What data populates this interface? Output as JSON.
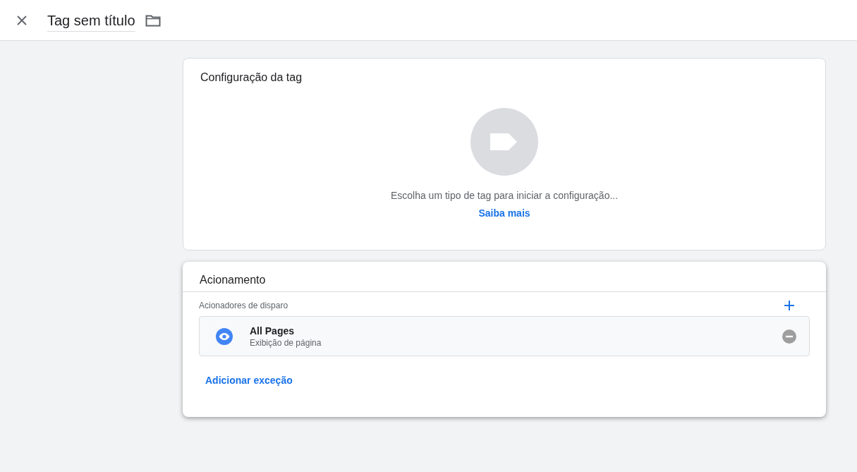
{
  "header": {
    "title": "Tag sem título"
  },
  "tag_configuration": {
    "title": "Configuração da tag",
    "prompt": "Escolha um tipo de tag para iniciar a configuração...",
    "link": "Saiba mais"
  },
  "triggering": {
    "title": "Acionamento",
    "section_label": "Acionadores de disparo",
    "triggers": [
      {
        "name": "All Pages",
        "type": "Exibição de página"
      }
    ],
    "exception_link": "Adicionar exceção"
  }
}
